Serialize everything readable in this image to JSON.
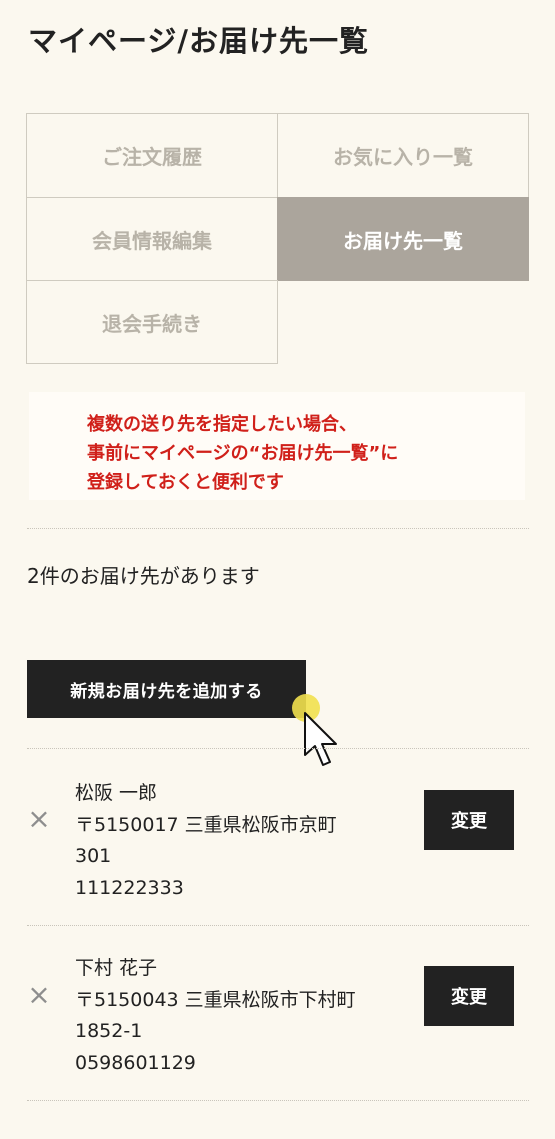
{
  "page_title": "マイページ/お届け先一覧",
  "menu": {
    "items": [
      {
        "label": "ご注文履歴"
      },
      {
        "label": "お気に入り一覧"
      },
      {
        "label": "会員情報編集"
      },
      {
        "label": "お届け先一覧"
      },
      {
        "label": "退会手続き"
      }
    ],
    "active": "お届け先一覧"
  },
  "notice": {
    "lines": [
      "複数の送り先を指定したい場合、",
      "事前にマイページの“お届け先一覧”に",
      "登録しておくと便利です"
    ],
    "color": "#d0201a"
  },
  "count_text": "2件のお届け先があります",
  "add_button_label": "新規お届け先を追加する",
  "addresses": [
    {
      "name": "松阪 一郎",
      "address": "〒5150017 三重県松阪市京町",
      "address2": "301",
      "phone": "111222333",
      "change_label": "変更"
    },
    {
      "name": "下村 花子",
      "address": "〒5150043 三重県松阪市下村町",
      "address2": "1852-1",
      "phone": "0598601129",
      "change_label": "変更"
    }
  ],
  "icons": {
    "remove": "close-icon",
    "cursor": "mouse-pointer-icon"
  },
  "colors": {
    "background": "#fbf8ef",
    "active_tab": "#aba59c",
    "button": "#222222"
  }
}
